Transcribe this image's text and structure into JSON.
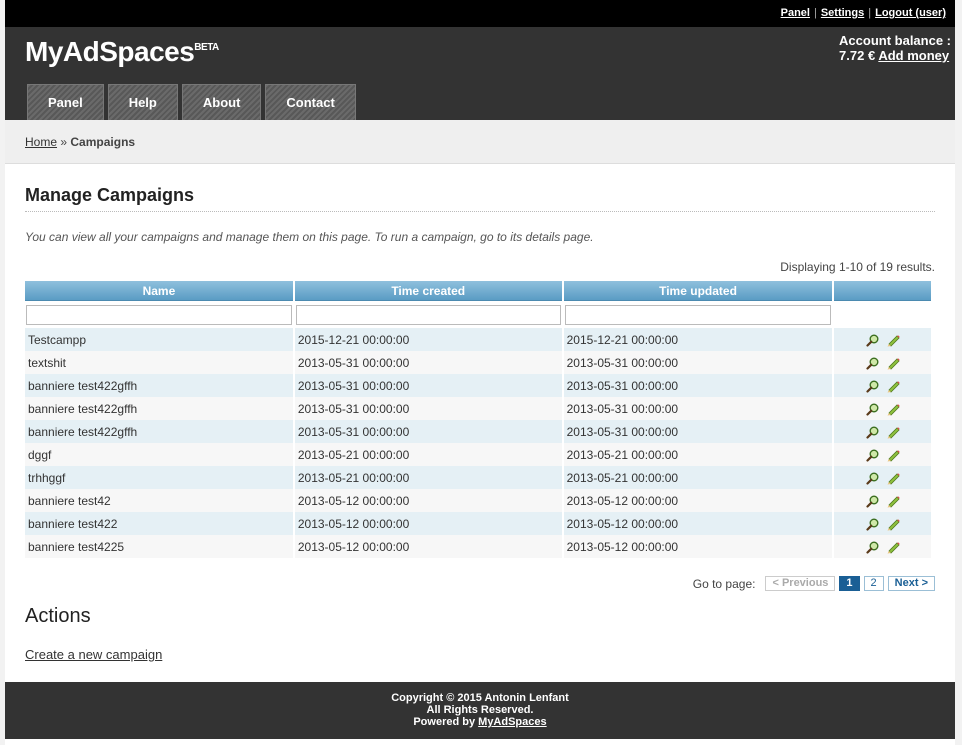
{
  "toplinks": [
    "Panel",
    "Settings",
    "Logout (user)"
  ],
  "logo": {
    "name": "MyAdSpaces",
    "badge": "BETA"
  },
  "balance": {
    "label": "Account balance :",
    "value": "7.72 €",
    "add_money": "Add money"
  },
  "nav": [
    "Panel",
    "Help",
    "About",
    "Contact"
  ],
  "breadcrumb": {
    "home": "Home",
    "sep": "»",
    "current": "Campaigns"
  },
  "page": {
    "title": "Manage Campaigns",
    "description": "You can view all your campaigns and manage them on this page. To run a campaign, go to its details page.",
    "summary": "Displaying 1-10 of 19 results."
  },
  "table": {
    "columns": [
      "Name",
      "Time created",
      "Time updated"
    ],
    "rows": [
      {
        "name": "Testcampp",
        "created": "2015-12-21 00:00:00",
        "updated": "2015-12-21 00:00:00"
      },
      {
        "name": "textshit",
        "created": "2013-05-31 00:00:00",
        "updated": "2013-05-31 00:00:00"
      },
      {
        "name": "banniere test422gffh",
        "created": "2013-05-31 00:00:00",
        "updated": "2013-05-31 00:00:00"
      },
      {
        "name": "banniere test422gffh",
        "created": "2013-05-31 00:00:00",
        "updated": "2013-05-31 00:00:00"
      },
      {
        "name": "banniere test422gffh",
        "created": "2013-05-31 00:00:00",
        "updated": "2013-05-31 00:00:00"
      },
      {
        "name": "dggf",
        "created": "2013-05-21 00:00:00",
        "updated": "2013-05-21 00:00:00"
      },
      {
        "name": "trhhggf",
        "created": "2013-05-21 00:00:00",
        "updated": "2013-05-21 00:00:00"
      },
      {
        "name": "banniere test42",
        "created": "2013-05-12 00:00:00",
        "updated": "2013-05-12 00:00:00"
      },
      {
        "name": "banniere test422",
        "created": "2013-05-12 00:00:00",
        "updated": "2013-05-12 00:00:00"
      },
      {
        "name": "banniere test4225",
        "created": "2013-05-12 00:00:00",
        "updated": "2013-05-12 00:00:00"
      }
    ],
    "row_icons": [
      "view-icon",
      "edit-icon"
    ]
  },
  "pager": {
    "label": "Go to page:",
    "previous": "< Previous",
    "pages": [
      "1",
      "2"
    ],
    "current": "1",
    "next": "Next >"
  },
  "actions": {
    "title": "Actions",
    "create": "Create a new campaign"
  },
  "footer": {
    "line1": "Copyright © 2015 Antonin Lenfant",
    "line2": "All Rights Reserved.",
    "powered_by": "Powered by",
    "powered_link": "MyAdSpaces"
  },
  "colors": {
    "header": "#333333",
    "table_header": "#5a9cc4",
    "row_alt": "#e5f0f5",
    "pager_selected": "#1a5f95"
  }
}
